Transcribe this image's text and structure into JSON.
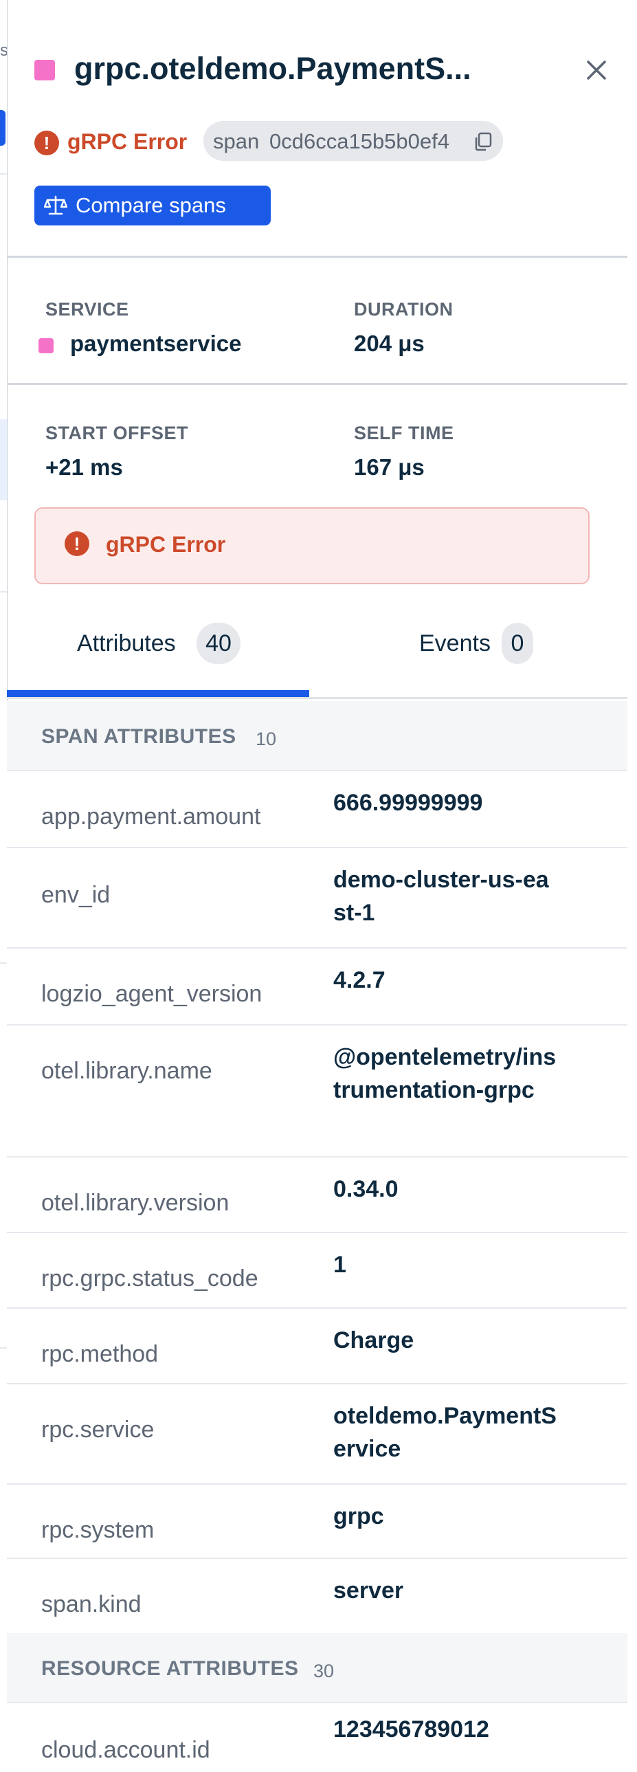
{
  "background": {
    "partial_text": "s"
  },
  "header": {
    "title": "grpc.oteldemo.PaymentS...",
    "service_color": "#f472c8"
  },
  "status": {
    "error_icon": "!",
    "error_label": "gRPC Error",
    "span_key": "span",
    "span_id": "0cd6cca15b5b0ef4"
  },
  "compare_button": {
    "label": "Compare spans"
  },
  "meta": {
    "service_label": "SERVICE",
    "service_value": "paymentservice",
    "duration_label": "DURATION",
    "duration_value": "204 μs",
    "start_offset_label": "START OFFSET",
    "start_offset_value": "+21 ms",
    "self_time_label": "SELF TIME",
    "self_time_value": "167 μs"
  },
  "error_banner": {
    "icon": "!",
    "label": "gRPC Error"
  },
  "tabs": [
    {
      "label": "Attributes",
      "count": "40"
    },
    {
      "label": "Events",
      "count": "0"
    }
  ],
  "span_attributes": {
    "title": "SPAN ATTRIBUTES",
    "count": "10",
    "rows": [
      {
        "key": "app.payment.amount",
        "value": "666.99999999"
      },
      {
        "key": "env_id",
        "value": "demo-cluster-us-east-1"
      },
      {
        "key": "logzio_agent_version",
        "value": "4.2.7"
      },
      {
        "key": "otel.library.name",
        "value": "@opentelemetry/instrumentation-grpc"
      },
      {
        "key": "otel.library.version",
        "value": "0.34.0"
      },
      {
        "key": "rpc.grpc.status_code",
        "value": "1"
      },
      {
        "key": "rpc.method",
        "value": "Charge"
      },
      {
        "key": "rpc.service",
        "value": "oteldemo.PaymentService"
      },
      {
        "key": "rpc.system",
        "value": "grpc"
      },
      {
        "key": "span.kind",
        "value": "server"
      }
    ]
  },
  "resource_attributes": {
    "title": "RESOURCE ATTRIBUTES",
    "count": "30",
    "rows": [
      {
        "key": "cloud.account.id",
        "value": "123456789012"
      }
    ]
  },
  "colors": {
    "accent": "#1a5ae6",
    "error": "#cc4a2a",
    "error_bg": "#fdecec",
    "service": "#f472c8"
  }
}
